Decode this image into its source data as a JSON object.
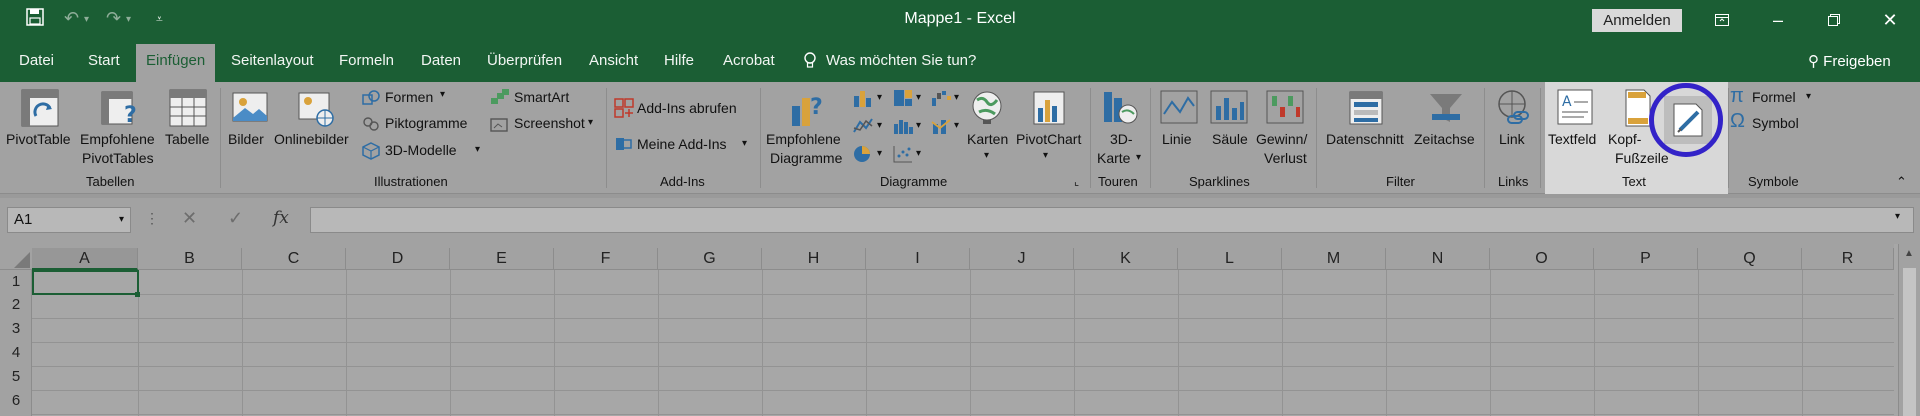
{
  "window": {
    "title": "Mappe1  -  Excel",
    "signin": "Anmelden",
    "share": "Freigeben"
  },
  "tabs": [
    "Datei",
    "Start",
    "Einfügen",
    "Seitenlayout",
    "Formeln",
    "Daten",
    "Überprüfen",
    "Ansicht",
    "Hilfe",
    "Acrobat"
  ],
  "active_tab": "Einfügen",
  "tell_me": "Was möchten Sie tun?",
  "ribbon": {
    "tables": {
      "group": "Tabellen",
      "pivot": "PivotTable",
      "rec_pivot_1": "Empfohlene",
      "rec_pivot_2": "PivotTables",
      "table": "Tabelle"
    },
    "illustrations": {
      "group": "Illustrationen",
      "pictures": "Bilder",
      "online": "Onlinebilder",
      "shapes": "Formen",
      "icons": "Piktogramme",
      "models": "3D-Modelle",
      "smartart": "SmartArt",
      "screenshot": "Screenshot"
    },
    "addins": {
      "group": "Add-Ins",
      "get": "Add-Ins abrufen",
      "mine": "Meine Add-Ins"
    },
    "charts": {
      "group": "Diagramme",
      "rec_1": "Empfohlene",
      "rec_2": "Diagramme",
      "maps": "Karten",
      "pivotchart": "PivotChart"
    },
    "tours": {
      "group": "Touren",
      "map3d_1": "3D-",
      "map3d_2": "Karte"
    },
    "sparklines": {
      "group": "Sparklines",
      "line": "Linie",
      "column": "Säule",
      "winloss_1": "Gewinn/",
      "winloss_2": "Verlust"
    },
    "filter": {
      "group": "Filter",
      "slicer": "Datenschnitt",
      "timeline": "Zeitachse"
    },
    "links": {
      "group": "Links",
      "link": "Link"
    },
    "text": {
      "group": "Text",
      "textbox": "Textfeld",
      "header_1": "Kopf-",
      "header_2": "Fußzeile"
    },
    "symbols": {
      "group": "Symbole",
      "equation": "Formel",
      "symbol": "Symbol"
    }
  },
  "namebox": "A1",
  "fx": "fx",
  "columns": [
    "A",
    "B",
    "C",
    "D",
    "E",
    "F",
    "G",
    "H",
    "I",
    "J",
    "K",
    "L",
    "M",
    "N",
    "O",
    "P",
    "Q",
    "R"
  ],
  "rows": [
    "1",
    "2",
    "3",
    "4",
    "5",
    "6"
  ],
  "colors": {
    "excel_green": "#1b5e34",
    "highlight_ring": "#3323c8"
  }
}
